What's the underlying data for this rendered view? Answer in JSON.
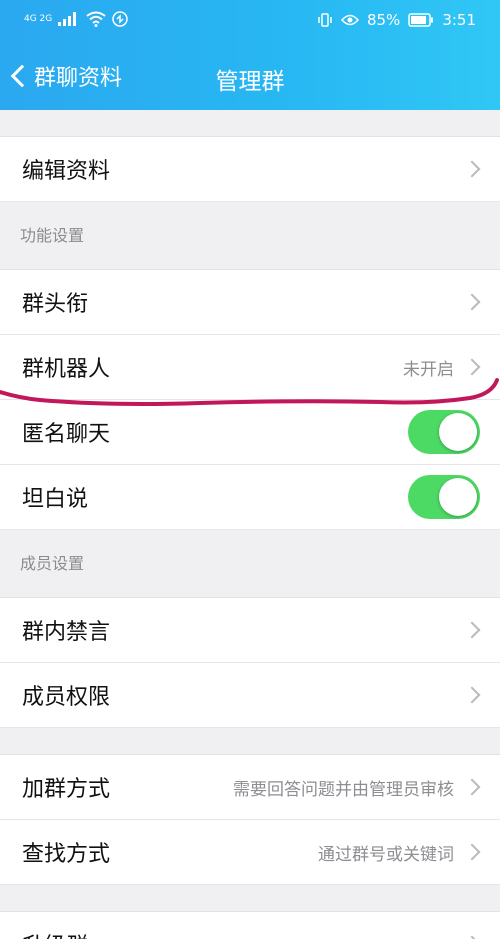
{
  "status_bar": {
    "signal": "4G 2G",
    "battery": "85%",
    "time": "3:51"
  },
  "nav": {
    "back_label": "群聊资料",
    "title": "管理群"
  },
  "rows": {
    "edit_profile": "编辑资料",
    "section_function": "功能设置",
    "group_title": "群头衔",
    "group_robot": "群机器人",
    "group_robot_value": "未开启",
    "anonymous_chat": "匿名聊天",
    "anonymous_chat_on": true,
    "tanbaishuo": "坦白说",
    "tanbaishuo_on": true,
    "section_member": "成员设置",
    "group_mute": "群内禁言",
    "member_permission": "成员权限",
    "join_method": "加群方式",
    "join_method_value": "需要回答问题并由管理员审核",
    "search_method": "查找方式",
    "search_method_value": "通过群号或关键词",
    "upgrade_group": "升级群"
  },
  "colors": {
    "header_blue": "#2aa8f0",
    "toggle_green": "#4cd964",
    "annotation_pink": "#c2185b"
  }
}
